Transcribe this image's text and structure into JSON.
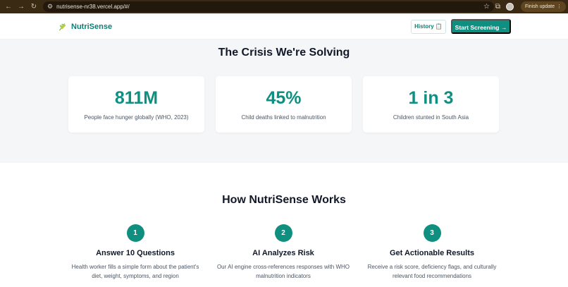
{
  "browser": {
    "url": "nutrisense-nr38.vercel.app/#/",
    "update_label": "Finish update",
    "icons": [
      "back-arrow-icon",
      "forward-arrow-icon",
      "reload-icon",
      "site-info-icon",
      "star-icon",
      "extensions-icon",
      "profile-avatar",
      "menu-dots-icon"
    ]
  },
  "header": {
    "brand": "NutriSense",
    "brand_icon": "wheat-icon",
    "history_label": "History 📋",
    "start_label": "Start Screening →"
  },
  "crisis": {
    "title": "The Crisis We're Solving",
    "stats": [
      {
        "value": "811M",
        "label": "People face hunger globally (WHO, 2023)"
      },
      {
        "value": "45%",
        "label": "Child deaths linked to malnutrition"
      },
      {
        "value": "1 in 3",
        "label": "Children stunted in South Asia"
      }
    ]
  },
  "works": {
    "title": "How NutriSense Works",
    "steps": [
      {
        "number": "1",
        "title": "Answer 10 Questions",
        "description": "Health worker fills a simple form about the patient's diet, weight, symptoms, and region"
      },
      {
        "number": "2",
        "title": "AI Analyzes Risk",
        "description": "Our AI engine cross-references responses with WHO malnutrition indicators"
      },
      {
        "number": "3",
        "title": "Get Actionable Results",
        "description": "Receive a risk score, deficiency flags, and culturally relevant food recommendations"
      }
    ]
  },
  "colors": {
    "accent": "#0f8f80",
    "brand_text": "#0d7f72",
    "section_bg": "#f5f6f8",
    "chrome_bg": "#3a2a14"
  }
}
